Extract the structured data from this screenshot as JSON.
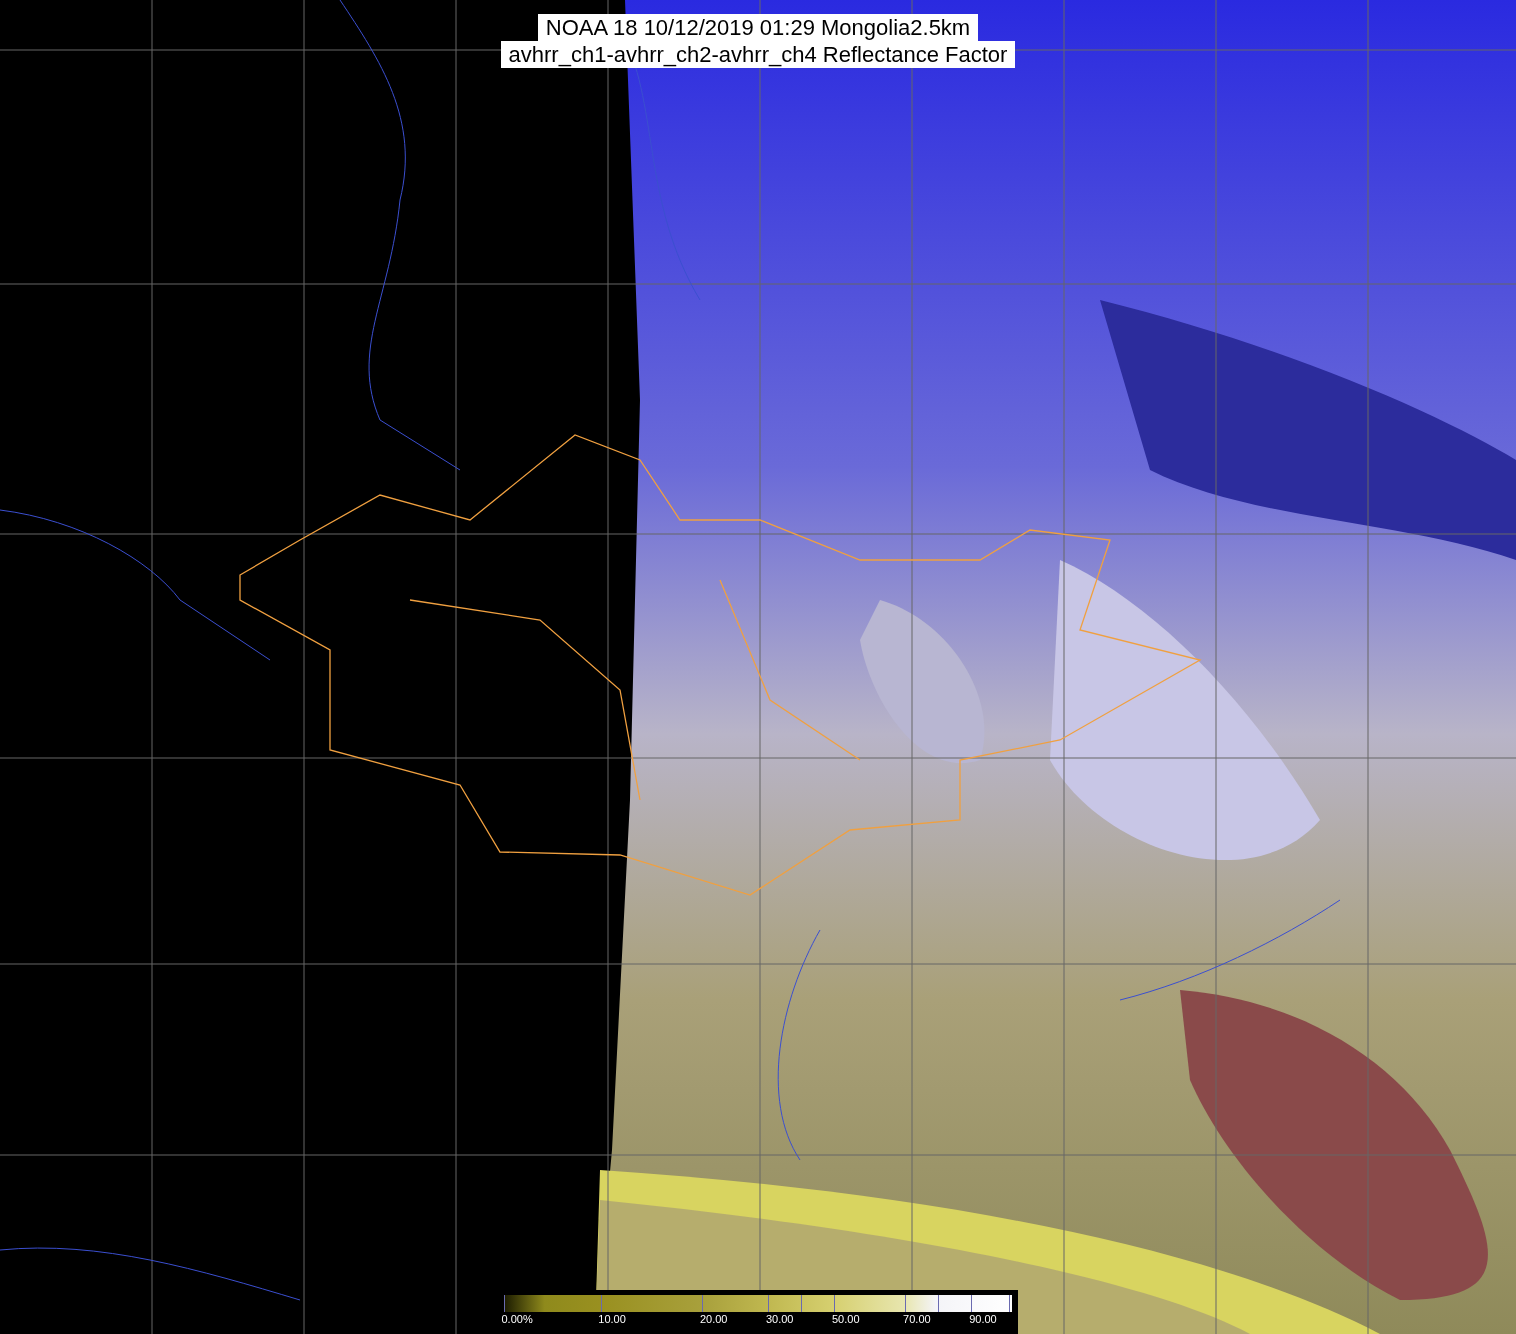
{
  "title": {
    "lines": [
      "NOAA 18 10/12/2019 01:29 Mongolia2.5km",
      "avhrr_ch1-avhrr_ch2-avhrr_ch4 Reflectance Factor"
    ]
  },
  "colorbar": {
    "ticks": [
      "0.00%",
      "10.00",
      "20.00",
      "30.00",
      "50.00",
      "70.00",
      "90.00"
    ]
  }
}
